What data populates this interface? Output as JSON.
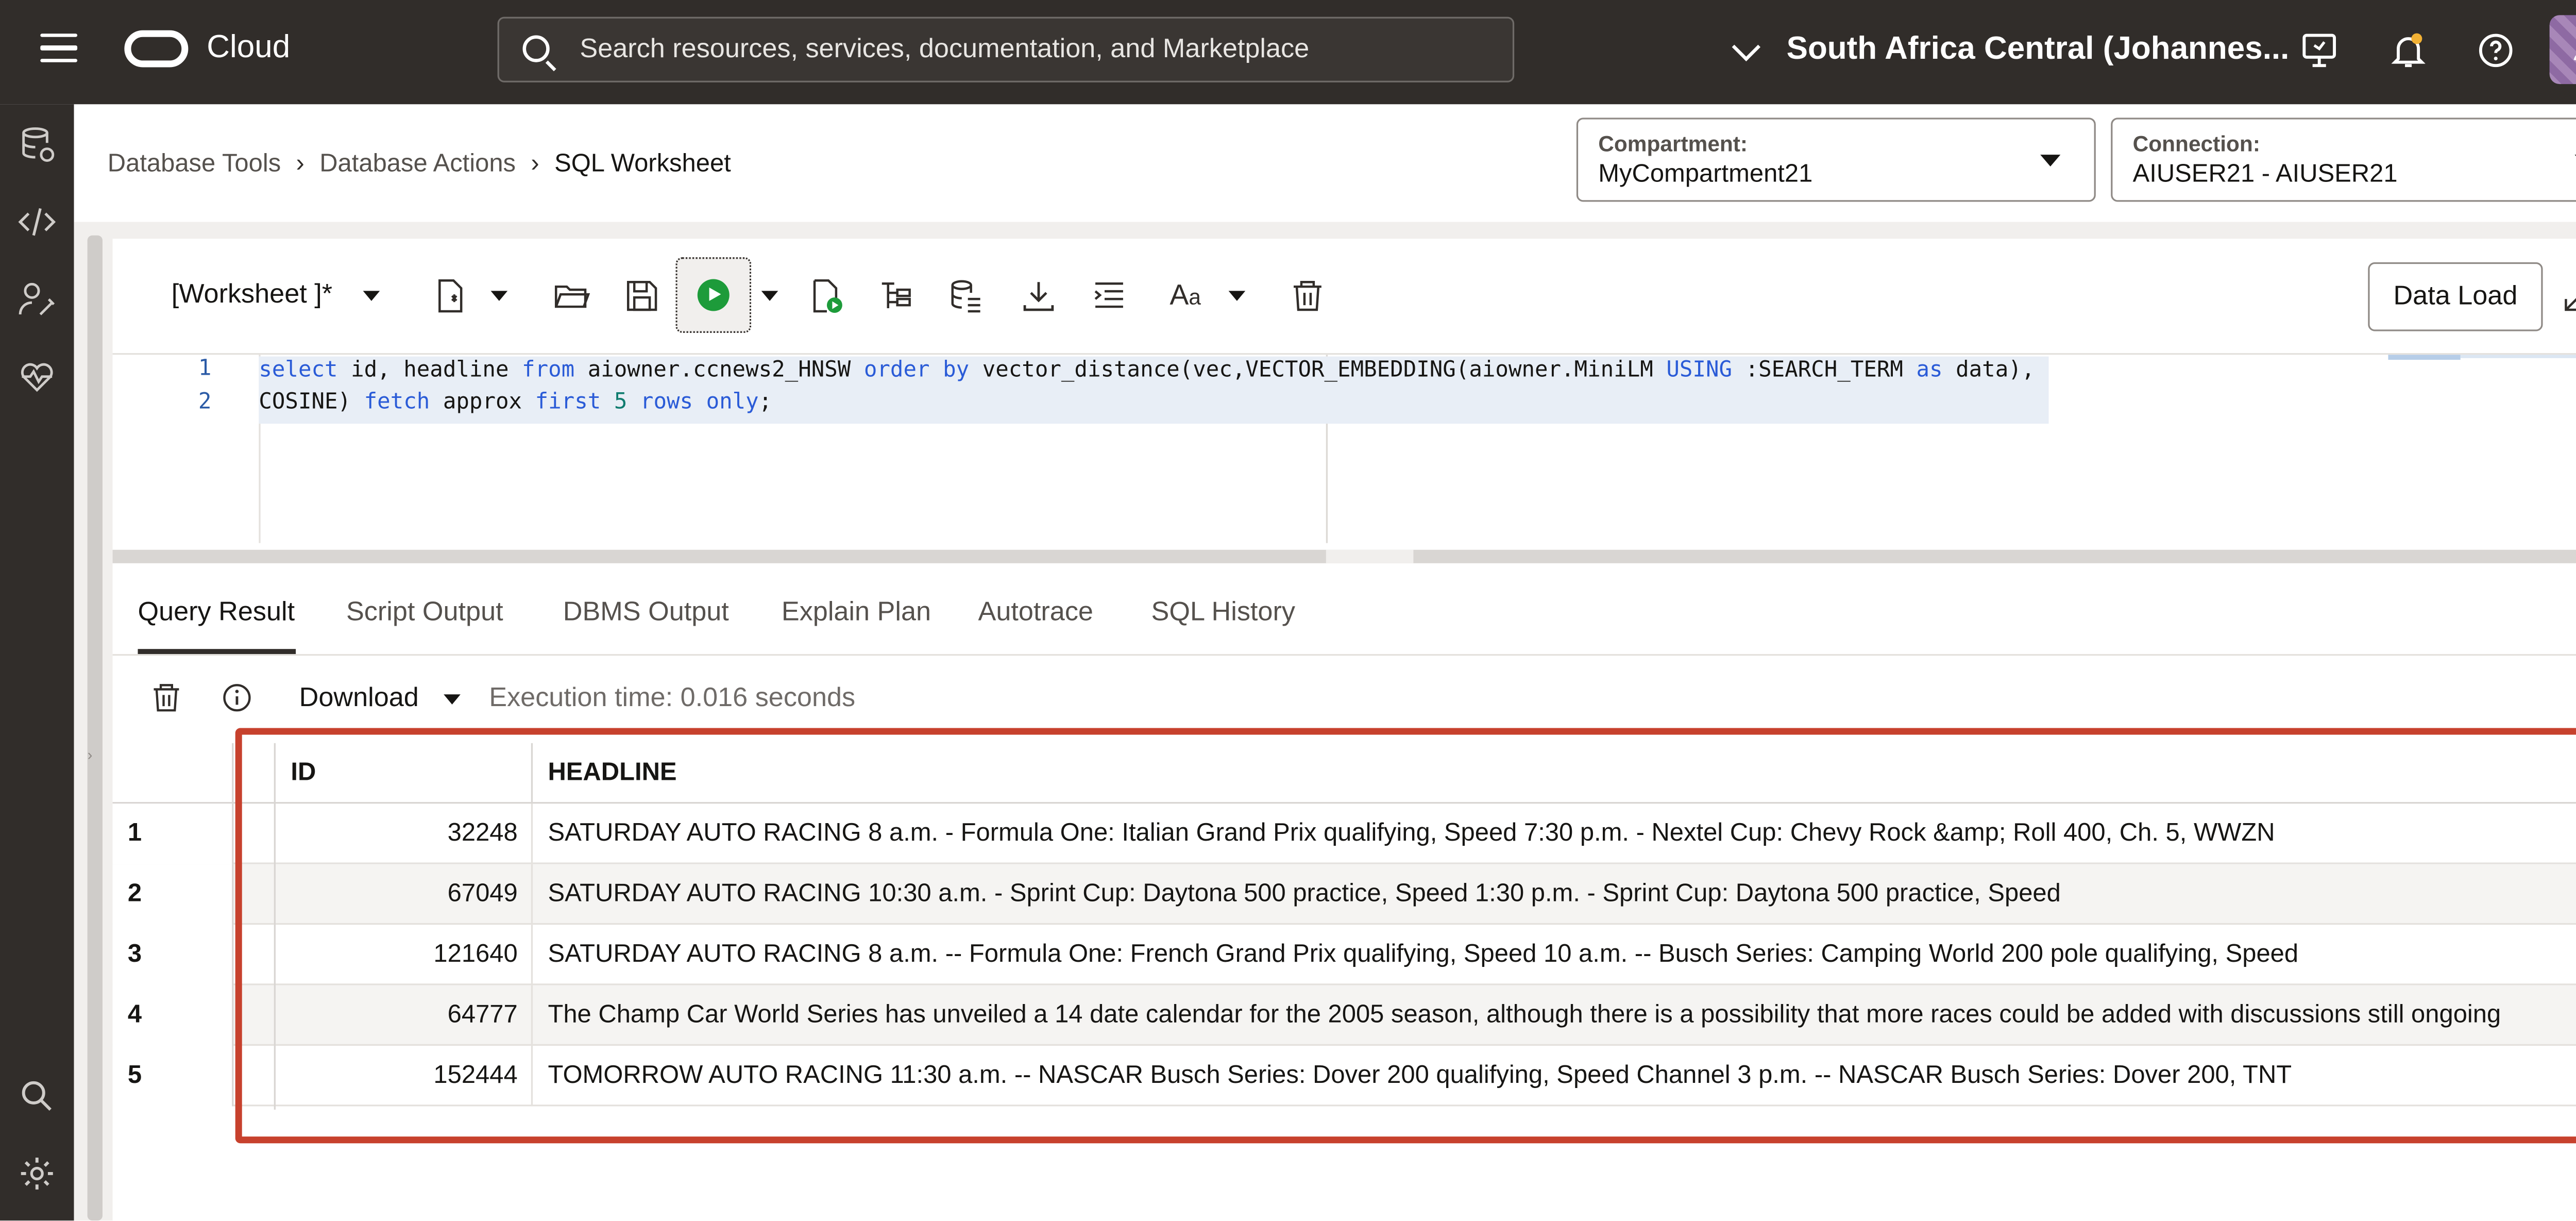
{
  "topbar": {
    "brand": "Cloud",
    "search_placeholder": "Search resources, services, documentation, and Marketplace",
    "region": "South Africa Central (Johannes...",
    "icons": [
      "menu-icon",
      "oracle-logo",
      "search-icon",
      "chevron-down-icon",
      "monitor-icon",
      "bell-icon",
      "help-icon",
      "user-icon"
    ],
    "colors": {
      "bar_bg": "#312d2a",
      "text": "#ffffff",
      "notification_dot": "#f2b134"
    }
  },
  "rail": {
    "icons": [
      "database-icon",
      "code-icon",
      "user-tool-icon",
      "heart-pulse-icon",
      "search-icon",
      "gear-icon"
    ]
  },
  "breadcrumb": {
    "items": [
      "Database Tools",
      "Database Actions",
      "SQL Worksheet"
    ]
  },
  "compartment": {
    "label": "Compartment:",
    "value": "MyCompartment21"
  },
  "connection": {
    "label": "Connection:",
    "value": "AIUSER21 - AIUSER21"
  },
  "toolbar": {
    "worksheet_label": "[Worksheet ]*",
    "data_load_label": "Data Load",
    "icons": [
      "new-worksheet-icon",
      "open-icon",
      "save-icon",
      "run-icon",
      "run-script-icon",
      "explain-plan-icon",
      "autotrace-icon",
      "download-icon",
      "format-icon",
      "font-size-icon",
      "clear-icon",
      "expand-icon"
    ],
    "run_color": "#1d9b3a"
  },
  "editor": {
    "line_numbers": [
      "1",
      "2"
    ],
    "sql": "select id, headline from aiowner.ccnews2_HNSW order by vector_distance(vec,VECTOR_EMBEDDING(aiowner.MiniLM USING :SEARCH_TERM as data), COSINE) fetch approx first 5 rows only;"
  },
  "tabs": [
    {
      "label": "Query Result",
      "active": true
    },
    {
      "label": "Script Output",
      "active": false
    },
    {
      "label": "DBMS Output",
      "active": false
    },
    {
      "label": "Explain Plan",
      "active": false
    },
    {
      "label": "Autotrace",
      "active": false
    },
    {
      "label": "SQL History",
      "active": false
    }
  ],
  "results": {
    "download_label": "Download",
    "execution_time": "Execution time: 0.016 seconds",
    "columns": [
      "ID",
      "HEADLINE"
    ],
    "rows": [
      {
        "n": "1",
        "id": "32248",
        "headline": "SATURDAY AUTO RACING 8 a.m. - Formula One: Italian Grand Prix qualifying, Speed 7:30 p.m. - Nextel Cup: Chevy Rock &amp; Roll 400, Ch. 5, WWZN"
      },
      {
        "n": "2",
        "id": "67049",
        "headline": "SATURDAY AUTO RACING 10:30 a.m. - Sprint Cup: Daytona 500 practice, Speed 1:30 p.m. - Sprint Cup: Daytona 500 practice, Speed"
      },
      {
        "n": "3",
        "id": "121640",
        "headline": "SATURDAY AUTO RACING 8 a.m. -- Formula One: French Grand Prix qualifying, Speed 10 a.m. -- Busch Series: Camping World 200 pole qualifying, Speed"
      },
      {
        "n": "4",
        "id": "64777",
        "headline": "The Champ Car World Series has unveiled a 14 date calendar for the 2005 season, although there is a possibility that more races could be added with discussions still ongoing"
      },
      {
        "n": "5",
        "id": "152444",
        "headline": "TOMORROW AUTO RACING 11:30 a.m. -- NASCAR Busch Series: Dover 200 qualifying, Speed Channel 3 p.m. -- NASCAR Busch Series: Dover 200, TNT"
      }
    ],
    "highlight_color": "#c7412d"
  }
}
